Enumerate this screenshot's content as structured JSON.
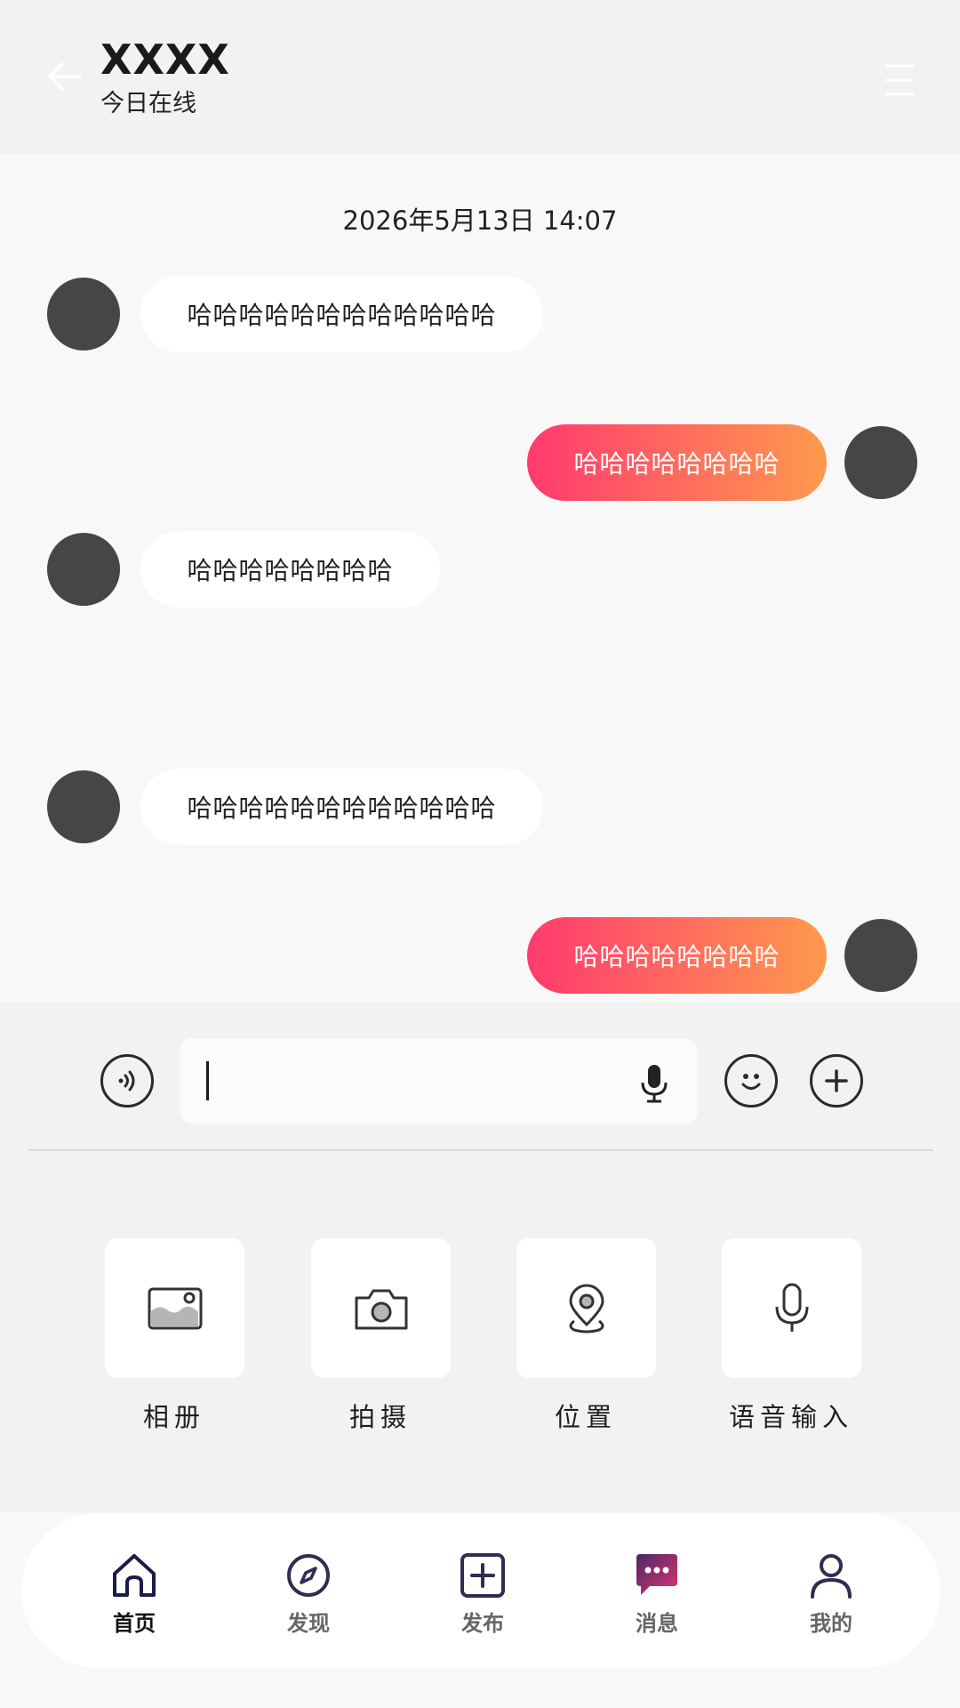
{
  "header": {
    "title": "XXXX",
    "status": "今日在线",
    "back_icon": "arrow-left-icon",
    "menu_icon": "menu-icon"
  },
  "chat": {
    "timestamp": "2026年5月13日 14:07",
    "messages": [
      {
        "direction": "in",
        "text": "哈哈哈哈哈哈哈哈哈哈哈哈"
      },
      {
        "direction": "out",
        "text": "哈哈哈哈哈哈哈哈"
      },
      {
        "direction": "in",
        "text": "哈哈哈哈哈哈哈哈"
      },
      {
        "direction": "in",
        "text": "哈哈哈哈哈哈哈哈哈哈哈哈"
      },
      {
        "direction": "out",
        "text": "哈哈哈哈哈哈哈哈"
      }
    ]
  },
  "input": {
    "value": "",
    "voice_icon": "voice-mode-icon",
    "mic_icon": "microphone-icon",
    "emoji_icon": "emoji-icon",
    "add_icon": "plus-icon"
  },
  "tools": [
    {
      "label": "相册",
      "icon": "photo-album-icon"
    },
    {
      "label": "拍摄",
      "icon": "camera-icon"
    },
    {
      "label": "位置",
      "icon": "location-icon"
    },
    {
      "label": "语音输入",
      "icon": "microphone-icon"
    }
  ],
  "tabbar": [
    {
      "label": "首页",
      "icon": "home-icon",
      "active": true
    },
    {
      "label": "发现",
      "icon": "compass-icon",
      "active": false
    },
    {
      "label": "发布",
      "icon": "add-post-icon",
      "active": false
    },
    {
      "label": "消息",
      "icon": "message-icon",
      "active": false
    },
    {
      "label": "我的",
      "icon": "user-icon",
      "active": false
    }
  ],
  "colors": {
    "outgoing_start": "#ff3a6e",
    "outgoing_end": "#ff9a4e",
    "avatar": "#464646",
    "message_icon": "#c2185b"
  }
}
